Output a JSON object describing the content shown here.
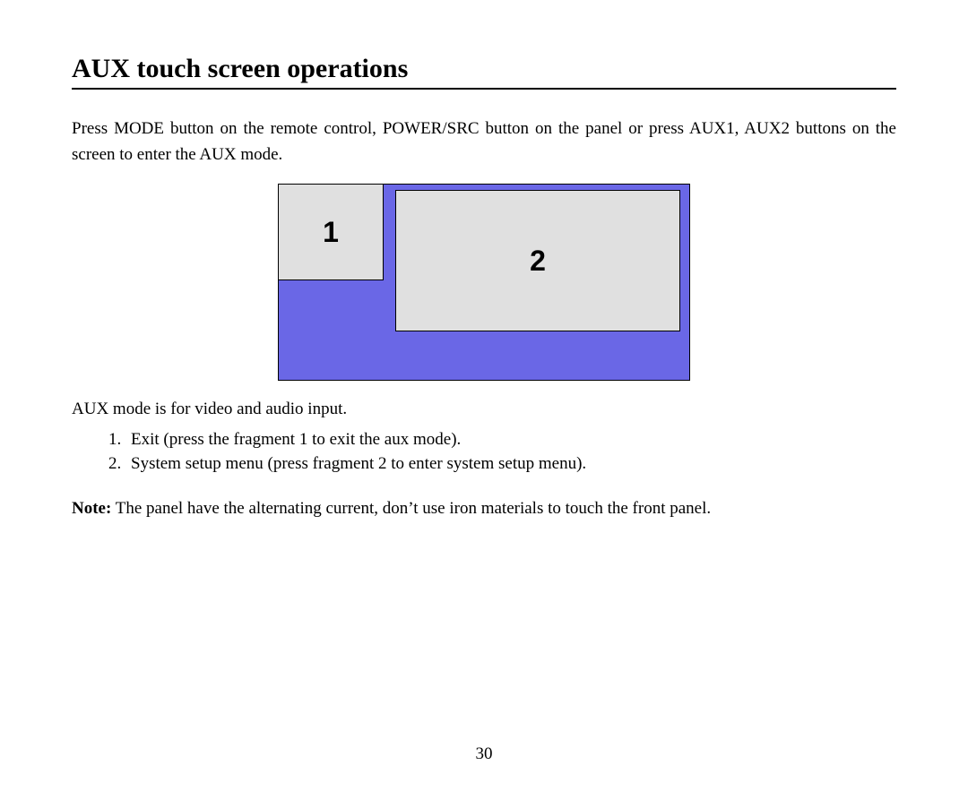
{
  "title": "AUX touch screen operations",
  "intro": "Press MODE button on the remote control, POWER/SRC button on the panel or press AUX1, AUX2 buttons on the screen to enter the AUX mode.",
  "figure": {
    "label1": "1",
    "label2": "2"
  },
  "body": "AUX mode is for video and audio input.",
  "steps": [
    "Exit (press the fragment 1 to exit the aux mode).",
    "System setup menu (press fragment 2 to enter system setup menu)."
  ],
  "note_label": "Note:",
  "note_text": " The panel have the alternating current, don’t use iron materials to touch the front panel.",
  "page_number": "30"
}
